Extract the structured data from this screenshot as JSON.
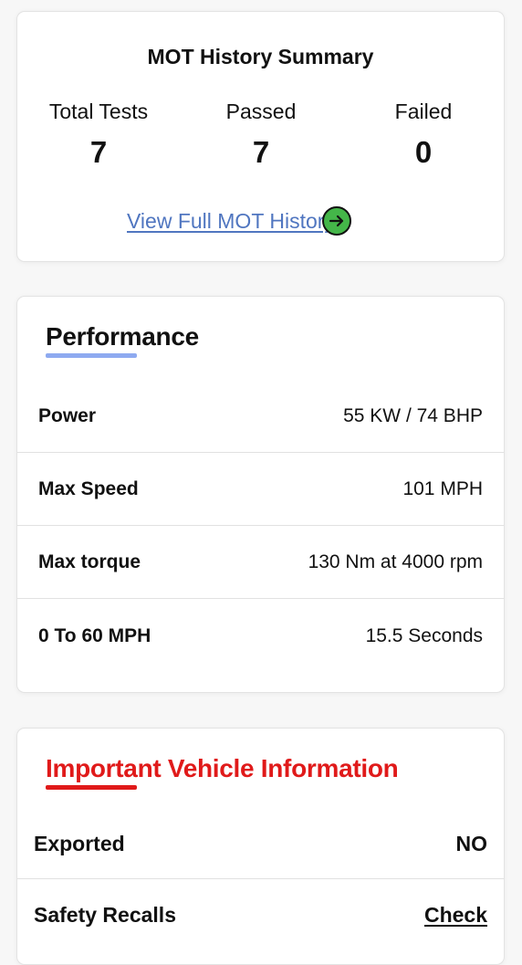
{
  "mot_summary": {
    "title": "MOT History Summary",
    "stats": [
      {
        "label": "Total Tests",
        "value": "7"
      },
      {
        "label": "Passed",
        "value": "7"
      },
      {
        "label": "Failed",
        "value": "0"
      }
    ],
    "link_label": "View Full MOT History",
    "link_icon": "arrow-right-circle-icon",
    "link_color": "#5076c0",
    "icon_color": "#44b649"
  },
  "performance": {
    "title": "Performance",
    "accent_color": "#8eaaf0",
    "rows": [
      {
        "label": "Power",
        "value": "55 KW / 74 BHP"
      },
      {
        "label": "Max Speed",
        "value": "101 MPH"
      },
      {
        "label": "Max torque",
        "value": "130 Nm at 4000 rpm"
      },
      {
        "label": "0 To 60 MPH",
        "value": "15.5 Seconds"
      }
    ]
  },
  "important_info": {
    "title": "Important Vehicle Information",
    "accent_color": "#e01a1a",
    "rows": [
      {
        "label": "Exported",
        "value": "NO"
      },
      {
        "label": "Safety Recalls",
        "value": "Check"
      }
    ]
  }
}
